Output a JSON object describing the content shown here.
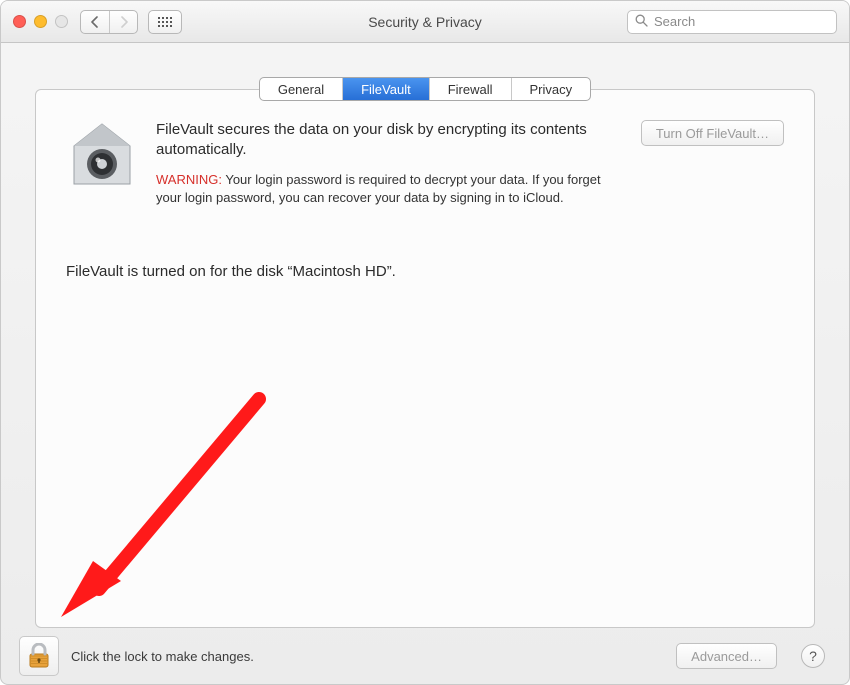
{
  "window": {
    "title": "Security & Privacy"
  },
  "search": {
    "placeholder": "Search"
  },
  "tabs": [
    {
      "label": "General",
      "active": false
    },
    {
      "label": "FileVault",
      "active": true
    },
    {
      "label": "Firewall",
      "active": false
    },
    {
      "label": "Privacy",
      "active": false
    }
  ],
  "filevault": {
    "description": "FileVault secures the data on your disk by encrypting its contents automatically.",
    "turnoff_label": "Turn Off FileVault…",
    "warning_label": "WARNING:",
    "warning_text": " Your login password is required to decrypt your data. If you forget your login password, you can recover your data by signing in to iCloud.",
    "status": "FileVault is turned on for the disk “Macintosh HD”."
  },
  "footer": {
    "lock_text": "Click the lock to make changes.",
    "advanced_label": "Advanced…",
    "help_label": "?"
  }
}
